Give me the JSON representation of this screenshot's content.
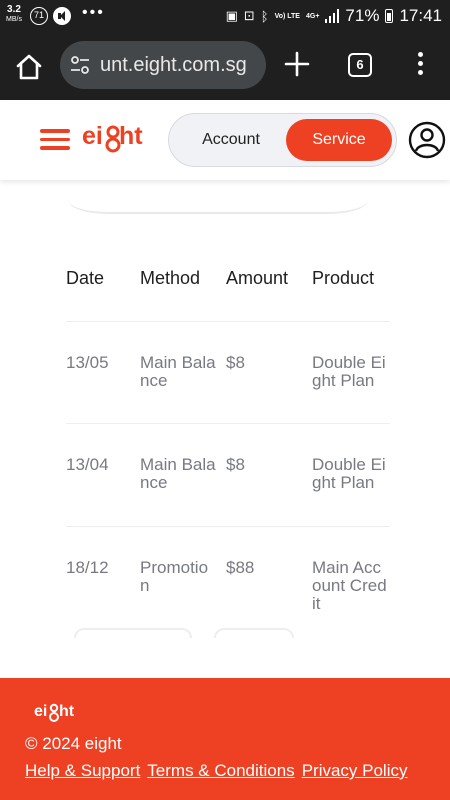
{
  "status_bar": {
    "net_speed": "3.2",
    "net_unit": "MB/s",
    "notif_count": "71",
    "lte_label": "Vo) LTE",
    "signal_label": "4G+",
    "battery_pct": "71%",
    "time": "17:41"
  },
  "browser": {
    "url": "unt.eight.com.sg",
    "tab_count": "6"
  },
  "header": {
    "logo_text": "eight",
    "segment_account": "Account",
    "segment_service": "Service"
  },
  "table": {
    "headers": [
      "Date",
      "Method",
      "Amount",
      "Product"
    ],
    "rows": [
      {
        "date": "13/05",
        "method": "Main Balance",
        "amount": "$8",
        "product": "Double Eight Plan"
      },
      {
        "date": "13/04",
        "method": "Main Balance",
        "amount": "$8",
        "product": "Double Eight Plan"
      },
      {
        "date": "18/12",
        "method": "Promotion",
        "amount": "$88",
        "product": "Main Account Credit"
      }
    ]
  },
  "footer": {
    "logo_text": "eight",
    "copyright": "© 2024 eight",
    "links": [
      "Help & Support",
      "Terms & Conditions",
      "Privacy Policy"
    ]
  },
  "colors": {
    "brand": "#ee4123",
    "browser_bg": "#1f1f1f",
    "url_box": "#444749"
  }
}
